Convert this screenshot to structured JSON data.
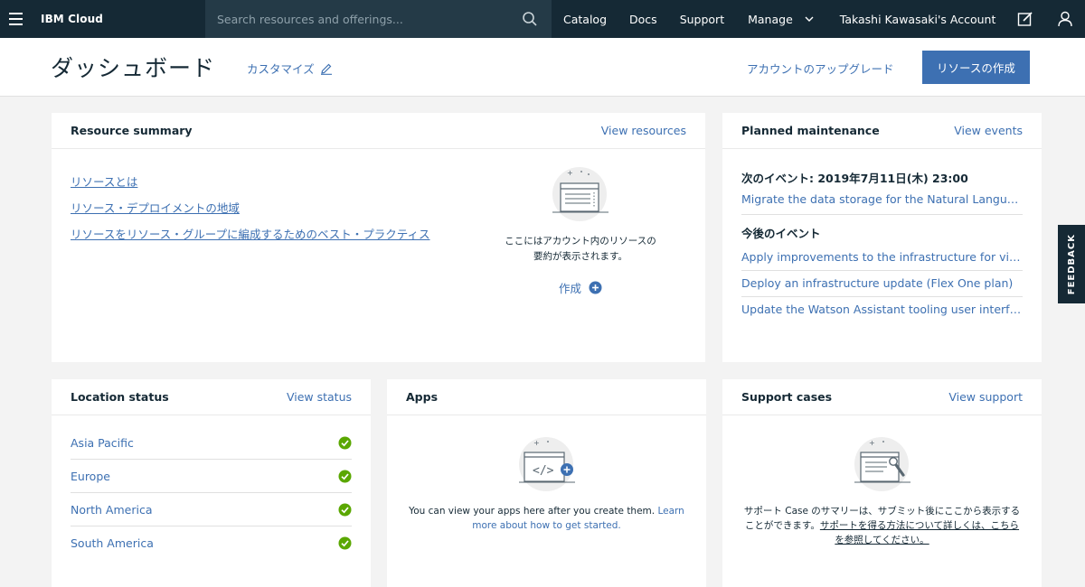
{
  "topnav": {
    "brand": "IBM Cloud",
    "search_placeholder": "Search resources and offerings...",
    "catalog": "Catalog",
    "docs": "Docs",
    "support": "Support",
    "manage": "Manage",
    "account": "Takashi Kawasaki's Account"
  },
  "header": {
    "title": "ダッシュボード",
    "customize": "カスタマイズ",
    "upgrade": "アカウントのアップグレード",
    "create_resource": "リソースの作成"
  },
  "resource_summary": {
    "title": "Resource summary",
    "view_link": "View resources",
    "links": [
      "リソースとは",
      "リソース・デプロイメントの地域",
      "リソースをリソース・グループに編成するためのベスト・プラクティス"
    ],
    "empty_line1": "ここにはアカウント内のリソースの",
    "empty_line2": "要約が表示されます。",
    "create": "作成"
  },
  "maintenance": {
    "title": "Planned maintenance",
    "view_link": "View events",
    "next_label": "次のイベント: 2019年7月11日(木) 23:00",
    "next_event": "Migrate the data storage for the Natural Language Classifier",
    "upcoming_label": "今後のイベント",
    "upcoming": [
      "Apply improvements to the infrastructure for virtual servers",
      "Deploy an infrastructure update (Flex One plan)",
      "Update the Watson Assistant tooling user interface"
    ]
  },
  "location_status": {
    "title": "Location status",
    "view_link": "View status",
    "locations": [
      "Asia Pacific",
      "Europe",
      "North America",
      "South America"
    ]
  },
  "apps": {
    "title": "Apps",
    "desc": "You can view your apps here after you create them. ",
    "learn_more": "Learn more about how to get started."
  },
  "support_cases": {
    "title": "Support cases",
    "view_link": "View support",
    "desc": "サポート Case のサマリーは、サブミット後にここから表示することができます。",
    "link": "サポートを得る方法について詳しくは、こちらを参照してください。"
  },
  "feedback": "FEEDBACK",
  "colors": {
    "nav_bg": "#152935",
    "search_bg": "#243a47",
    "accent": "#3d70b2",
    "success": "#5aa700",
    "page_bg": "#f3f3f3"
  }
}
